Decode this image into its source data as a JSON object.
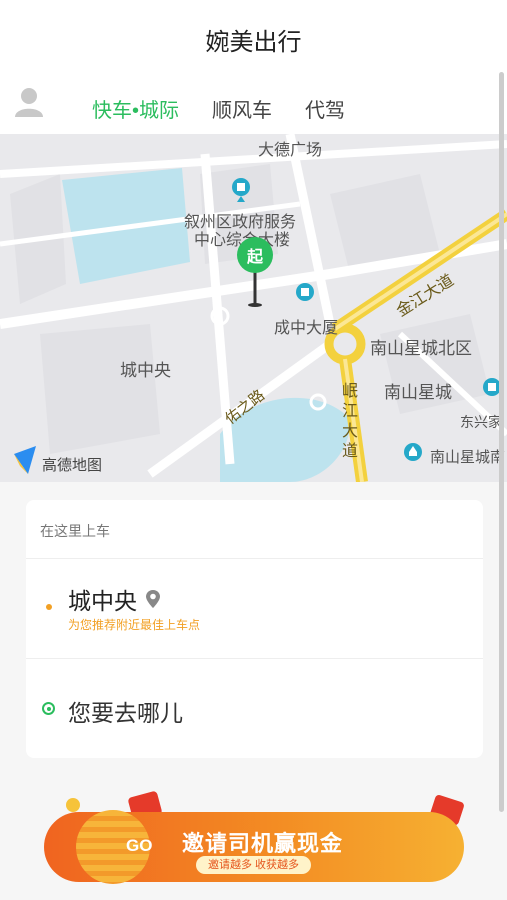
{
  "header": {
    "title": "婉美出行"
  },
  "tabs": {
    "items": [
      {
        "label": "快车•城际",
        "active": true
      },
      {
        "label": "顺风车",
        "active": false
      },
      {
        "label": "代驾",
        "active": false
      }
    ]
  },
  "map": {
    "labels": {
      "plaza": "大德广场",
      "gov_center_line1": "叙州区政府服务",
      "gov_center_line2": "中心综合大楼",
      "chengzhong_building": "成中大厦",
      "jinjiang_road": "金江大道",
      "nanshan_north": "南山星城北区",
      "chengzhongyang": "城中央",
      "nanshan": "南山星城",
      "dongxing": "东兴家",
      "minjiang_road": "岷江大道",
      "youzhi_road": "佑之路",
      "nanshan_south": "南山星城南"
    },
    "pin_label": "起",
    "logo": "高德地图"
  },
  "pickup_card": {
    "hint": "在这里上车",
    "location": "城中央",
    "sub": "为您推荐附近最佳上车点",
    "destination_placeholder": "您要去哪儿"
  },
  "banner": {
    "go": "GO",
    "text": "邀请司机赢现金",
    "sub": "邀请越多 收获越多"
  },
  "colors": {
    "accent": "#2bbd5e",
    "orange": "#f2a024",
    "road_yellow": "#f3d13e"
  }
}
